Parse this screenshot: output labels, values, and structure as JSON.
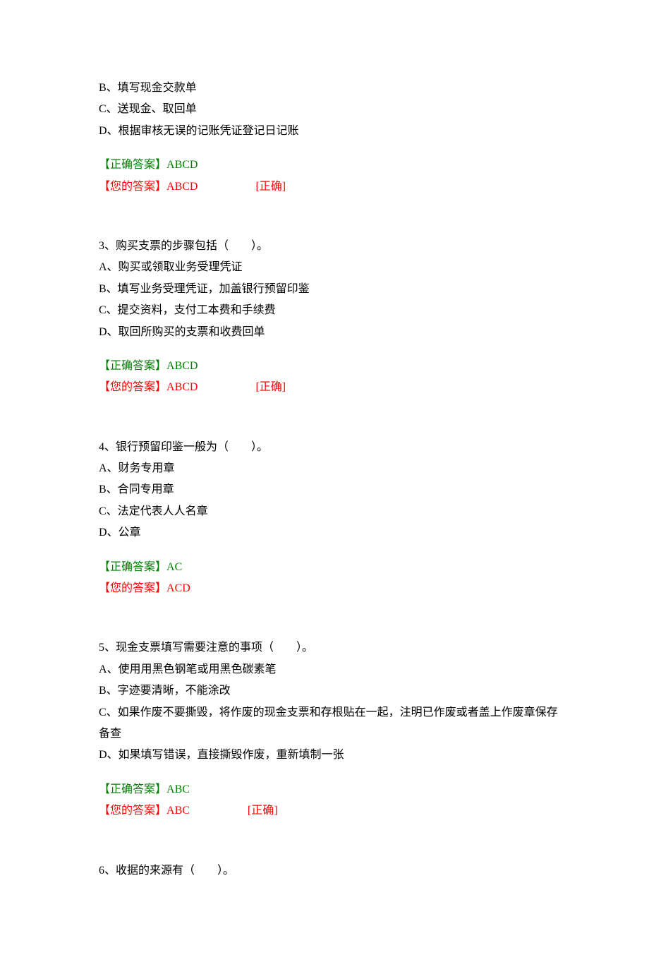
{
  "q2": {
    "options": {
      "B": "B、填写现金交款单",
      "C": "C、送现金、取回单",
      "D": "D、根据审核无误的记账凭证登记日记账"
    },
    "correct_label": "【正确答案】",
    "correct_value": "ABCD",
    "your_label": "【您的答案】",
    "your_value": "ABCD",
    "status": "[正确]"
  },
  "q3": {
    "stem": "3、购买支票的步骤包括（　　）。",
    "options": {
      "A": "A、购买或领取业务受理凭证",
      "B": "B、填写业务受理凭证，加盖银行预留印鉴",
      "C": "C、提交资料，支付工本费和手续费",
      "D": "D、取回所购买的支票和收费回单"
    },
    "correct_label": "【正确答案】",
    "correct_value": "ABCD",
    "your_label": "【您的答案】",
    "your_value": "ABCD",
    "status": "[正确]"
  },
  "q4": {
    "stem": "4、银行预留印鉴一般为（　　）。",
    "options": {
      "A": "A、财务专用章",
      "B": "B、合同专用章",
      "C": "C、法定代表人人名章",
      "D": "D、公章"
    },
    "correct_label": "【正确答案】",
    "correct_value": "AC",
    "your_label": "【您的答案】",
    "your_value": "ACD"
  },
  "q5": {
    "stem": "5、现金支票填写需要注意的事项（　　）。",
    "options": {
      "A": "A、使用用黑色钢笔或用黑色碳素笔",
      "B": "B、字迹要清晰，不能涂改",
      "C": "C、如果作废不要撕毁，将作废的现金支票和存根贴在一起，注明已作废或者盖上作废章保存备查",
      "D": "D、如果填写错误，直接撕毁作废，重新填制一张"
    },
    "correct_label": "【正确答案】",
    "correct_value": "ABC",
    "your_label": "【您的答案】",
    "your_value": "ABC",
    "status": "[正确]"
  },
  "q6": {
    "stem": "6、收据的来源有（　　）。"
  }
}
